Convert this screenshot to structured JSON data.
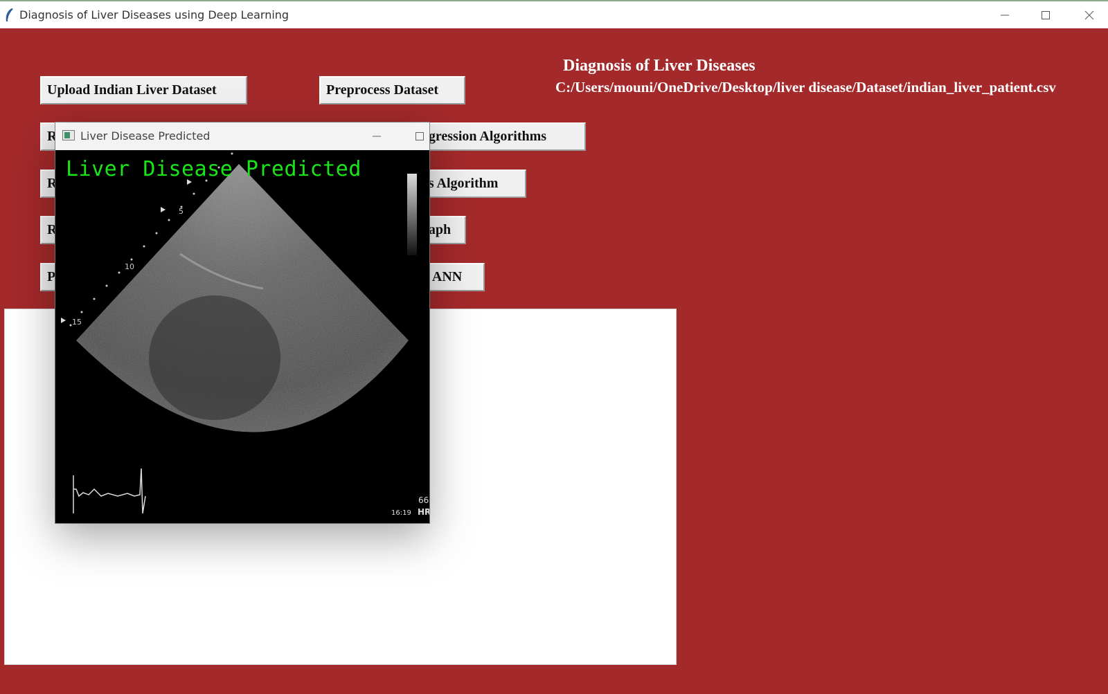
{
  "window": {
    "title": "Diagnosis of Liver Diseases using Deep Learning",
    "controls": [
      "minimize-icon",
      "maximize-icon",
      "close-icon"
    ]
  },
  "heading": {
    "title": "Diagnosis of Liver Diseases",
    "path": "C:/Users/mouni/OneDrive/Desktop/liver disease/Dataset/indian_liver_patient.csv"
  },
  "buttons": {
    "upload": "Upload Indian Liver Dataset",
    "preprocess": "Preprocess Dataset",
    "row2_left": "R",
    "row2_right": "egression Algorithms",
    "row3_left": "R",
    "row3_right": "es Algorithm",
    "row4_left": "R",
    "row4_right": "raph",
    "row5_left": "P",
    "row5_right": "g ANN"
  },
  "popup": {
    "title": "Liver Disease Predicted",
    "prediction_label": "Liver Disease Predicted",
    "depth_marks": [
      "5",
      "10",
      "15"
    ],
    "hr_value": "66",
    "hr_label": "HR",
    "time": "16:19"
  },
  "colors": {
    "background": "#a4292b",
    "prediction_text": "#19e619"
  }
}
